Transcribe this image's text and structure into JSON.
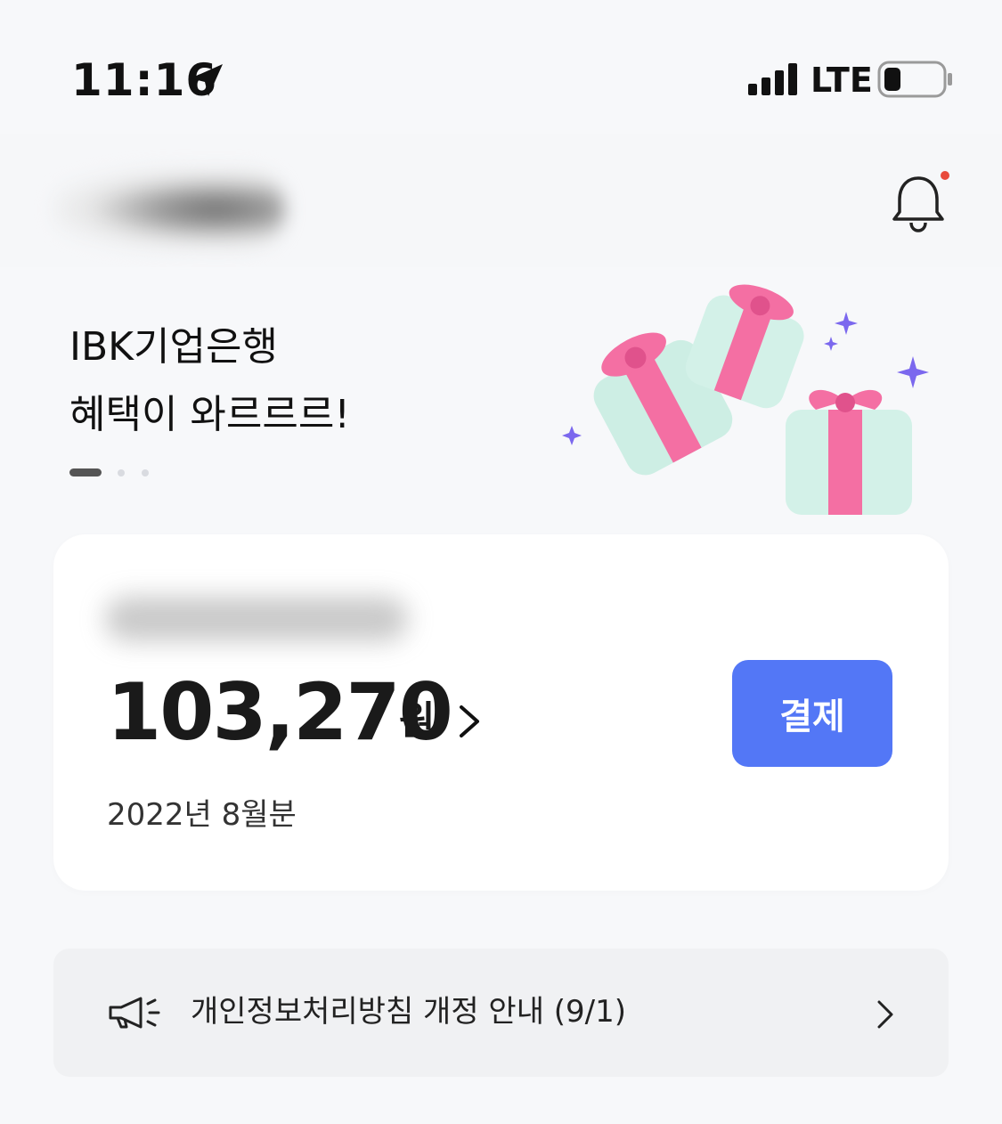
{
  "status_bar": {
    "time": "11:16",
    "network": "LTE",
    "icons": [
      "location-arrow-icon",
      "signal-bars-icon",
      "battery-low-icon"
    ]
  },
  "header": {
    "icons": [
      "bell-icon"
    ],
    "notification_dot_color": "#e84a3b"
  },
  "banner": {
    "title_line1": "IBK기업은행",
    "title_line2": "혜택이 와르르르!",
    "pager": {
      "total": 3,
      "current": 1
    },
    "illustration": "gift-boxes-icon"
  },
  "bill": {
    "amount": "103,270",
    "unit": "원",
    "pay_label": "결제",
    "period": "2022년 8월분",
    "accent_color": "#5377f6"
  },
  "notice": {
    "text": "개인정보처리방침 개정 안내 (9/1)",
    "icon": "megaphone-icon"
  }
}
